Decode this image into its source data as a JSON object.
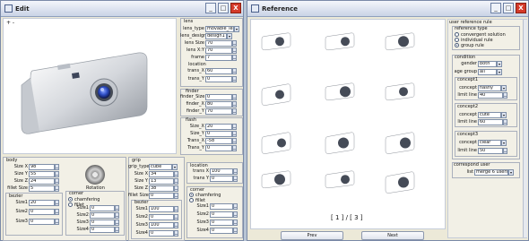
{
  "colors": {
    "accent": "#2f5bd0",
    "close": "#d43a2a"
  },
  "edit": {
    "title": "Edit",
    "axis_marker": "+ -",
    "controls": {
      "minimize": "_",
      "maximize": "□",
      "close": "X"
    },
    "lens": {
      "header": "lens",
      "type_label": "lens_type",
      "type_value": "movable_lens",
      "design_label": "lens_design",
      "design_value": "design1",
      "size_label": "lens Size",
      "size_value": "70",
      "xy_label": "lens X:Y",
      "xy_value": "70",
      "frame_label": "frame",
      "frame_value": "7",
      "location_header": "location",
      "transx_label": "trans_X",
      "transx_value": "60",
      "transy_label": "trans_Y",
      "transy_value": "0"
    },
    "finder": {
      "header": "finder",
      "size_label": "finder_Size",
      "size_value": "0",
      "x_label": "finder_X",
      "x_value": "80",
      "y_label": "finder_Y",
      "y_value": "70"
    },
    "flash": {
      "header": "flash",
      "sizex_label": "Size_X",
      "sizex_value": "20",
      "sizey_label": "Size_Y",
      "sizey_value": "0",
      "transx_label": "Trans_X",
      "transx_value": "-58",
      "transy_label": "Trans_Y",
      "transy_value": "0"
    },
    "body": {
      "header": "body",
      "sizex_label": "Size X",
      "sizex_value": "98",
      "sizey_label": "Size Y",
      "sizey_value": "55",
      "sizez_label": "Size Z",
      "sizez_value": "24",
      "fillet_label": "fillet Size",
      "fillet_value": "5",
      "bezier_header": "bezier",
      "s1_label": "Size1",
      "s1_value": "20",
      "s2_label": "Size2",
      "s2_value": "0",
      "s3_label": "Size3",
      "s3_value": "0"
    },
    "rotation_label": "Rotation",
    "corner": {
      "header": "corner",
      "opt1": "chamfering",
      "opt2": "fillet",
      "s1_label": "Size1",
      "s1_value": "0",
      "s2_label": "Size2",
      "s2_value": "0",
      "s3_label": "Size3",
      "s3_value": "0",
      "s4_label": "Size4",
      "s4_value": "0"
    },
    "grip": {
      "header": "grip",
      "type_label": "grip_type",
      "type_value": "cube",
      "sizex_label": "Size X",
      "sizex_value": "34",
      "sizey_label": "Size Y",
      "sizey_value": "13",
      "sizez_label": "Size Z",
      "sizez_value": "38",
      "fillet_label": "fillet Size",
      "fillet_value": "0",
      "bezier_header": "bezier",
      "s1_label": "Size1",
      "s1_value": "100",
      "s2_label": "Size2",
      "s2_value": "0",
      "s3_label": "Size3",
      "s3_value": "100",
      "s4_label": "Size4",
      "s4_value": "0"
    },
    "grip_location": {
      "header": "location",
      "transx_label": "trans X",
      "transx_value": "100",
      "transy_label": "trans Y",
      "transy_value": "0"
    },
    "grip_corner": {
      "header": "corner",
      "opt1": "chamfering",
      "opt2": "fillet",
      "s1_label": "Size1",
      "s1_value": "0",
      "s2_label": "Size2",
      "s2_value": "0",
      "s3_label": "Size3",
      "s3_value": "0",
      "s4_label": "Size4",
      "s4_value": "0"
    }
  },
  "reference": {
    "title": "Reference",
    "controls": {
      "minimize": "_",
      "maximize": "□",
      "close": "X"
    },
    "pager": "[ 1 ] / [ 3 ]",
    "prev_label": "Prev",
    "next_label": "Next",
    "rule_header": "user reference rule",
    "ref_type_header": "reference type",
    "ref_types": [
      "convergent solution",
      "individual rule",
      "group rule"
    ],
    "condition_header": "condition",
    "gender_label": "gender",
    "gender_value": "both",
    "age_label": "age group",
    "age_value": "all",
    "concepts": [
      {
        "header": "concept1",
        "concept_label": "concept",
        "concept_value": "flashy",
        "limit_label": "limit line",
        "limit_value": "40"
      },
      {
        "header": "concept2",
        "concept_label": "concept",
        "concept_value": "cute",
        "limit_label": "limit line",
        "limit_value": "60"
      },
      {
        "header": "concept3",
        "concept_label": "concept",
        "concept_value": "clear",
        "limit_label": "limit line",
        "limit_value": "50"
      }
    ],
    "correspond_header": "correspond user",
    "list_label": "list",
    "list_value": "merge 6 users"
  }
}
